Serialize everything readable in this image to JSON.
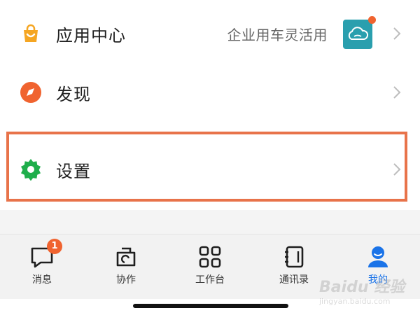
{
  "menu": {
    "items": [
      {
        "label": "应用中心",
        "extra": "企业用车灵活用",
        "icon": "shopping-bag-icon",
        "color": "#f5a623"
      },
      {
        "label": "发现",
        "icon": "compass-icon",
        "color": "#f0632f"
      },
      {
        "label": "设置",
        "icon": "gear-icon",
        "color": "#1fae4b"
      }
    ]
  },
  "highlight_color": "#e8734a",
  "tabbar": {
    "tabs": [
      {
        "label": "消息",
        "icon": "message-icon",
        "badge": "1"
      },
      {
        "label": "协作",
        "icon": "collaboration-icon"
      },
      {
        "label": "工作台",
        "icon": "grid-icon"
      },
      {
        "label": "通讯录",
        "icon": "contacts-icon"
      },
      {
        "label": "我的",
        "icon": "profile-icon",
        "active": true
      }
    ]
  },
  "watermark": {
    "text": "Baidu 经验",
    "subtext": "jingyan.baidu.com"
  }
}
